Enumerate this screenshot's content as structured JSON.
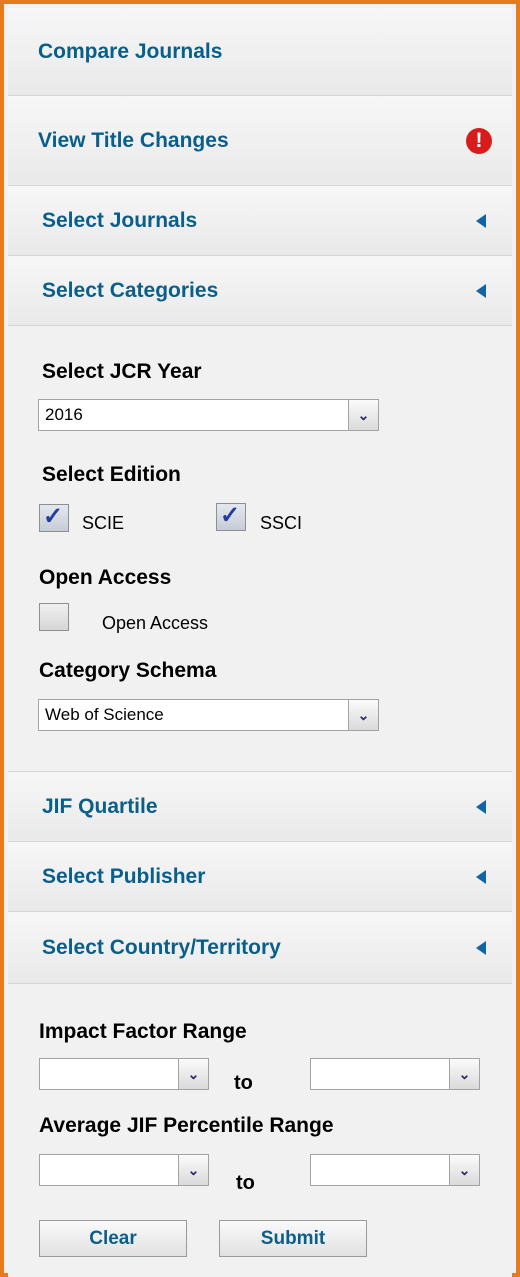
{
  "nav": {
    "compare_journals": "Compare Journals",
    "view_title_changes": "View Title Changes",
    "select_journals": "Select Journals",
    "select_categories": "Select Categories",
    "jif_quartile": "JIF Quartile",
    "select_publisher": "Select Publisher",
    "select_country": "Select Country/Territory"
  },
  "filters": {
    "jcr_year": {
      "label": "Select JCR Year",
      "value": "2016"
    },
    "edition": {
      "label": "Select Edition",
      "options": [
        {
          "label": "SCIE",
          "checked": true
        },
        {
          "label": "SSCI",
          "checked": true
        }
      ]
    },
    "open_access": {
      "label": "Open Access",
      "option_label": "Open Access",
      "checked": false
    },
    "category_schema": {
      "label": "Category Schema",
      "value": "Web of Science"
    }
  },
  "ranges": {
    "impact_factor": {
      "label": "Impact Factor Range",
      "from": "",
      "to": "",
      "separator": "to"
    },
    "jif_percentile": {
      "label": "Average JIF Percentile Range",
      "from": "",
      "to": "",
      "separator": "to"
    }
  },
  "buttons": {
    "clear": "Clear",
    "submit": "Submit"
  },
  "icons": {
    "alert": "!",
    "dropdown": "⌄"
  },
  "colors": {
    "accent": "#0a5f8a",
    "border": "#e87a1e",
    "alert": "#d81c1c"
  }
}
